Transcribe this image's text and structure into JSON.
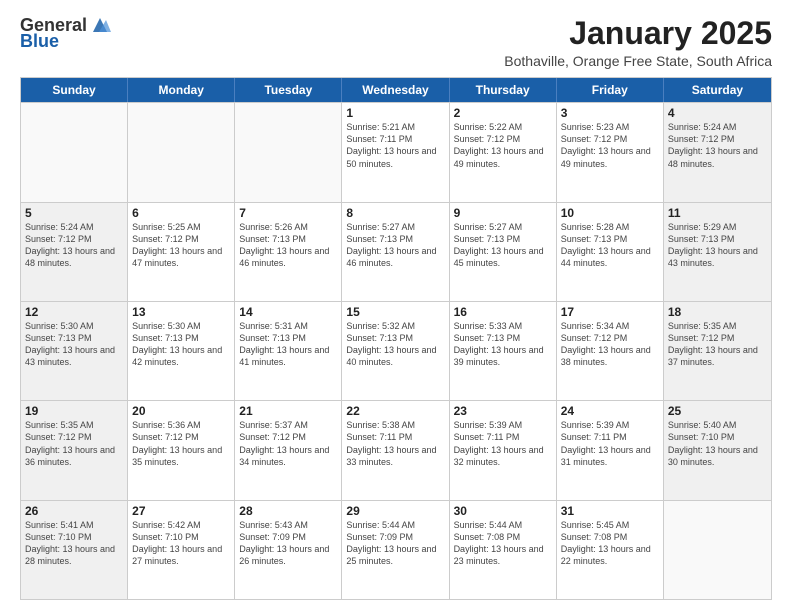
{
  "logo": {
    "general": "General",
    "blue": "Blue"
  },
  "title": "January 2025",
  "subtitle": "Bothaville, Orange Free State, South Africa",
  "header_days": [
    "Sunday",
    "Monday",
    "Tuesday",
    "Wednesday",
    "Thursday",
    "Friday",
    "Saturday"
  ],
  "weeks": [
    [
      {
        "day": "",
        "info": "",
        "empty": true
      },
      {
        "day": "",
        "info": "",
        "empty": true
      },
      {
        "day": "",
        "info": "",
        "empty": true
      },
      {
        "day": "1",
        "info": "Sunrise: 5:21 AM\nSunset: 7:11 PM\nDaylight: 13 hours\nand 50 minutes.",
        "empty": false
      },
      {
        "day": "2",
        "info": "Sunrise: 5:22 AM\nSunset: 7:12 PM\nDaylight: 13 hours\nand 49 minutes.",
        "empty": false
      },
      {
        "day": "3",
        "info": "Sunrise: 5:23 AM\nSunset: 7:12 PM\nDaylight: 13 hours\nand 49 minutes.",
        "empty": false
      },
      {
        "day": "4",
        "info": "Sunrise: 5:24 AM\nSunset: 7:12 PM\nDaylight: 13 hours\nand 48 minutes.",
        "empty": false,
        "shaded": true
      }
    ],
    [
      {
        "day": "5",
        "info": "Sunrise: 5:24 AM\nSunset: 7:12 PM\nDaylight: 13 hours\nand 48 minutes.",
        "empty": false,
        "shaded": true
      },
      {
        "day": "6",
        "info": "Sunrise: 5:25 AM\nSunset: 7:12 PM\nDaylight: 13 hours\nand 47 minutes.",
        "empty": false
      },
      {
        "day": "7",
        "info": "Sunrise: 5:26 AM\nSunset: 7:13 PM\nDaylight: 13 hours\nand 46 minutes.",
        "empty": false
      },
      {
        "day": "8",
        "info": "Sunrise: 5:27 AM\nSunset: 7:13 PM\nDaylight: 13 hours\nand 46 minutes.",
        "empty": false
      },
      {
        "day": "9",
        "info": "Sunrise: 5:27 AM\nSunset: 7:13 PM\nDaylight: 13 hours\nand 45 minutes.",
        "empty": false
      },
      {
        "day": "10",
        "info": "Sunrise: 5:28 AM\nSunset: 7:13 PM\nDaylight: 13 hours\nand 44 minutes.",
        "empty": false
      },
      {
        "day": "11",
        "info": "Sunrise: 5:29 AM\nSunset: 7:13 PM\nDaylight: 13 hours\nand 43 minutes.",
        "empty": false,
        "shaded": true
      }
    ],
    [
      {
        "day": "12",
        "info": "Sunrise: 5:30 AM\nSunset: 7:13 PM\nDaylight: 13 hours\nand 43 minutes.",
        "empty": false,
        "shaded": true
      },
      {
        "day": "13",
        "info": "Sunrise: 5:30 AM\nSunset: 7:13 PM\nDaylight: 13 hours\nand 42 minutes.",
        "empty": false
      },
      {
        "day": "14",
        "info": "Sunrise: 5:31 AM\nSunset: 7:13 PM\nDaylight: 13 hours\nand 41 minutes.",
        "empty": false
      },
      {
        "day": "15",
        "info": "Sunrise: 5:32 AM\nSunset: 7:13 PM\nDaylight: 13 hours\nand 40 minutes.",
        "empty": false
      },
      {
        "day": "16",
        "info": "Sunrise: 5:33 AM\nSunset: 7:13 PM\nDaylight: 13 hours\nand 39 minutes.",
        "empty": false
      },
      {
        "day": "17",
        "info": "Sunrise: 5:34 AM\nSunset: 7:12 PM\nDaylight: 13 hours\nand 38 minutes.",
        "empty": false
      },
      {
        "day": "18",
        "info": "Sunrise: 5:35 AM\nSunset: 7:12 PM\nDaylight: 13 hours\nand 37 minutes.",
        "empty": false,
        "shaded": true
      }
    ],
    [
      {
        "day": "19",
        "info": "Sunrise: 5:35 AM\nSunset: 7:12 PM\nDaylight: 13 hours\nand 36 minutes.",
        "empty": false,
        "shaded": true
      },
      {
        "day": "20",
        "info": "Sunrise: 5:36 AM\nSunset: 7:12 PM\nDaylight: 13 hours\nand 35 minutes.",
        "empty": false
      },
      {
        "day": "21",
        "info": "Sunrise: 5:37 AM\nSunset: 7:12 PM\nDaylight: 13 hours\nand 34 minutes.",
        "empty": false
      },
      {
        "day": "22",
        "info": "Sunrise: 5:38 AM\nSunset: 7:11 PM\nDaylight: 13 hours\nand 33 minutes.",
        "empty": false
      },
      {
        "day": "23",
        "info": "Sunrise: 5:39 AM\nSunset: 7:11 PM\nDaylight: 13 hours\nand 32 minutes.",
        "empty": false
      },
      {
        "day": "24",
        "info": "Sunrise: 5:39 AM\nSunset: 7:11 PM\nDaylight: 13 hours\nand 31 minutes.",
        "empty": false
      },
      {
        "day": "25",
        "info": "Sunrise: 5:40 AM\nSunset: 7:10 PM\nDaylight: 13 hours\nand 30 minutes.",
        "empty": false,
        "shaded": true
      }
    ],
    [
      {
        "day": "26",
        "info": "Sunrise: 5:41 AM\nSunset: 7:10 PM\nDaylight: 13 hours\nand 28 minutes.",
        "empty": false,
        "shaded": true
      },
      {
        "day": "27",
        "info": "Sunrise: 5:42 AM\nSunset: 7:10 PM\nDaylight: 13 hours\nand 27 minutes.",
        "empty": false
      },
      {
        "day": "28",
        "info": "Sunrise: 5:43 AM\nSunset: 7:09 PM\nDaylight: 13 hours\nand 26 minutes.",
        "empty": false
      },
      {
        "day": "29",
        "info": "Sunrise: 5:44 AM\nSunset: 7:09 PM\nDaylight: 13 hours\nand 25 minutes.",
        "empty": false
      },
      {
        "day": "30",
        "info": "Sunrise: 5:44 AM\nSunset: 7:08 PM\nDaylight: 13 hours\nand 23 minutes.",
        "empty": false
      },
      {
        "day": "31",
        "info": "Sunrise: 5:45 AM\nSunset: 7:08 PM\nDaylight: 13 hours\nand 22 minutes.",
        "empty": false
      },
      {
        "day": "",
        "info": "",
        "empty": true,
        "shaded": true
      }
    ]
  ]
}
